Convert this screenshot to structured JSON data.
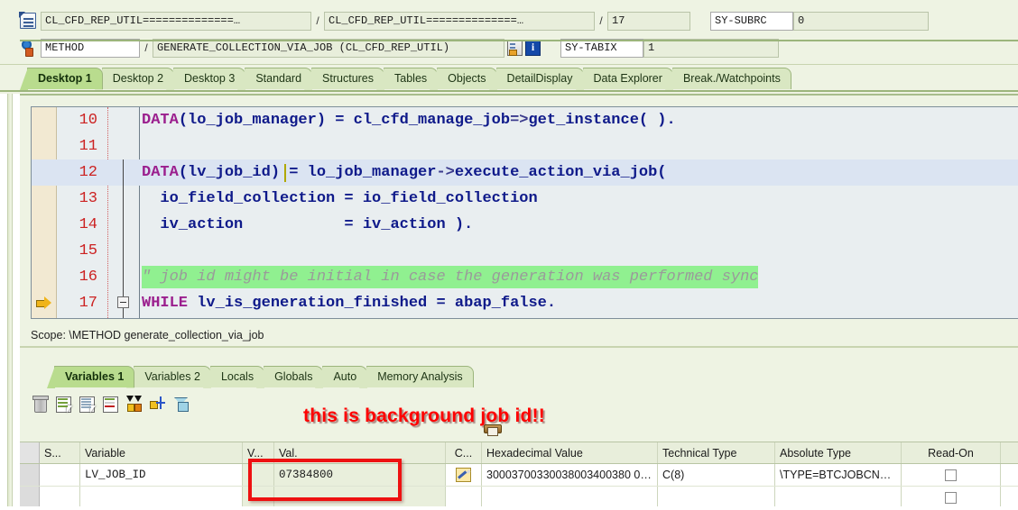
{
  "header": {
    "row1": {
      "icon": "program-icon",
      "program": "CL_CFD_REP_UTIL==============…",
      "separator1": "/",
      "include": "CL_CFD_REP_UTIL==============…",
      "separator2": "/",
      "line": "17",
      "sys_label": "SY-SUBRC",
      "sys_value": "0"
    },
    "row2": {
      "icon": "method-icon",
      "event_type": "METHOD",
      "separator1": "/",
      "event_name": "GENERATE_COLLECTION_VIA_JOB (CL_CFD_REP_UTIL)",
      "icon_list": "list-icon",
      "icon_info": "info-icon",
      "sys_label": "SY-TABIX",
      "sys_value": "1"
    }
  },
  "main_tabs": [
    {
      "label": "Desktop 1",
      "active": true
    },
    {
      "label": "Desktop 2",
      "active": false
    },
    {
      "label": "Desktop 3",
      "active": false
    },
    {
      "label": "Standard",
      "active": false
    },
    {
      "label": "Structures",
      "active": false
    },
    {
      "label": "Tables",
      "active": false
    },
    {
      "label": "Objects",
      "active": false
    },
    {
      "label": "DetailDisplay",
      "active": false
    },
    {
      "label": "Data Explorer",
      "active": false
    },
    {
      "label": "Break./Watchpoints",
      "active": false
    }
  ],
  "code": {
    "lines": [
      {
        "num": "10",
        "text": "DATA(lo_job_manager) = cl_cfd_manage_job=>get_instance( ).",
        "style": "normal",
        "highlighted": false,
        "current": false,
        "fold": false
      },
      {
        "num": "11",
        "text": "",
        "style": "normal",
        "highlighted": false,
        "current": false,
        "fold": false
      },
      {
        "num": "12",
        "text": "DATA(lv_job_id) = lo_job_manager->execute_action_via_job(",
        "style": "normal",
        "highlighted": true,
        "current": false,
        "fold": false
      },
      {
        "num": "13",
        "text": "  io_field_collection = io_field_collection",
        "style": "normal",
        "highlighted": false,
        "current": false,
        "fold": false
      },
      {
        "num": "14",
        "text": "  iv_action           = iv_action ).",
        "style": "normal",
        "highlighted": false,
        "current": false,
        "fold": false
      },
      {
        "num": "15",
        "text": "",
        "style": "normal",
        "highlighted": false,
        "current": false,
        "fold": false
      },
      {
        "num": "16",
        "text": "\" job id might be initial in case the generation was performed sync",
        "style": "comment",
        "highlighted": false,
        "current": false,
        "fold": false
      },
      {
        "num": "17",
        "text": "WHILE lv_is_generation_finished = abap_false.",
        "style": "normal",
        "highlighted": false,
        "current": true,
        "fold": true
      }
    ]
  },
  "scope": {
    "label": "Scope: \\METHOD generate_collection_via_job"
  },
  "var_tabs": [
    {
      "label": "Variables 1",
      "active": true
    },
    {
      "label": "Variables 2",
      "active": false
    },
    {
      "label": "Locals",
      "active": false
    },
    {
      "label": "Globals",
      "active": false
    },
    {
      "label": "Auto",
      "active": false
    },
    {
      "label": "Memory Analysis",
      "active": false
    }
  ],
  "var_toolbar": [
    {
      "name": "delete-icon"
    },
    {
      "name": "insert-row-icon"
    },
    {
      "name": "change-display-icon"
    },
    {
      "name": "remove-row-icon"
    },
    {
      "name": "collapse-all-icon"
    },
    {
      "name": "move-icon"
    },
    {
      "name": "filter-icon"
    }
  ],
  "annotation": {
    "text": "this is background job id!!",
    "color": "#ff0000"
  },
  "table": {
    "columns": [
      {
        "key": "grip",
        "label": ""
      },
      {
        "key": "sel",
        "label": "S..."
      },
      {
        "key": "var",
        "label": "Variable"
      },
      {
        "key": "vt",
        "label": "V..."
      },
      {
        "key": "val",
        "label": "Val."
      },
      {
        "key": "c",
        "label": "C..."
      },
      {
        "key": "hex",
        "label": "Hexadecimal Value"
      },
      {
        "key": "tech",
        "label": "Technical Type"
      },
      {
        "key": "abs",
        "label": "Absolute Type"
      },
      {
        "key": "read",
        "label": "Read-On"
      }
    ],
    "rows": [
      {
        "sel": "",
        "var": "LV_JOB_ID",
        "vt": "",
        "val": "07384800",
        "c": "pencil-icon",
        "hex": "30003700330038003400380 0…",
        "tech": "C(8)",
        "abs": "\\TYPE=BTCJOBCN…",
        "read": "checkbox"
      },
      {
        "sel": "",
        "var": "",
        "vt": "",
        "val": "",
        "c": "",
        "hex": "",
        "tech": "",
        "abs": "",
        "read": "checkbox"
      }
    ]
  },
  "colors": {
    "accent_green": "#b9dc8e",
    "tab_green": "#d9e7c2",
    "panel_bg": "#eef3e3",
    "editor_bg": "#e9eef0",
    "line_number": "#cc2222",
    "keyword": "#9b1f8e",
    "code": "#0f1a8a",
    "comment_highlight": "#90f090",
    "annotation_red": "#ff0000"
  }
}
